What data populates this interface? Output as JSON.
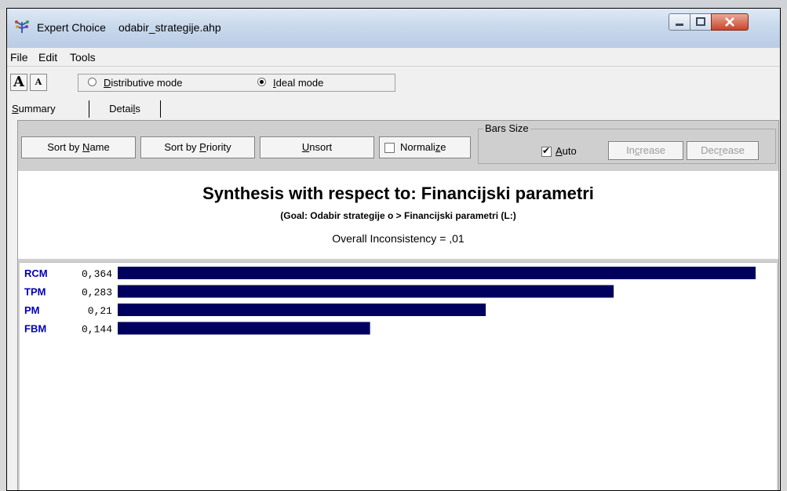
{
  "window": {
    "app_name": "Expert Choice",
    "file_name": "odabir_strategije.ahp"
  },
  "menu": [
    "File",
    "Edit",
    "Tools"
  ],
  "toolbar": {
    "font_up_label": "A",
    "font_down_label": "A",
    "modes": [
      {
        "label_prefix": "",
        "underline": "D",
        "label_rest": "istributive mode",
        "selected": false
      },
      {
        "label_prefix": "",
        "underline": "I",
        "label_rest": "deal mode",
        "selected": true
      }
    ]
  },
  "tabs": [
    {
      "prefix": "",
      "underline": "S",
      "rest": "ummary",
      "active": true
    },
    {
      "prefix": "Detai",
      "underline": "l",
      "rest": "s",
      "active": false
    }
  ],
  "buttons": {
    "sort_name": {
      "prefix": "Sort by ",
      "underline": "N",
      "rest": "ame"
    },
    "sort_priority": {
      "prefix": "Sort by ",
      "underline": "P",
      "rest": "riority"
    },
    "unsort": {
      "prefix": "",
      "underline": "U",
      "rest": "nsort"
    },
    "normalize": {
      "prefix": "Normali",
      "underline": "z",
      "rest": "e",
      "checked": false
    }
  },
  "bars_size": {
    "legend": "Bars Size",
    "auto": {
      "prefix": "",
      "underline": "A",
      "rest": "uto",
      "checked": true
    },
    "increase": {
      "prefix": "In",
      "underline": "c",
      "rest": "rease"
    },
    "decrease": {
      "prefix": "Dec",
      "underline": "r",
      "rest": "ease"
    }
  },
  "synthesis": {
    "title": "Synthesis with respect to: Financijski parametri",
    "goal": "(Goal: Odabir strategije o > Financijski parametri (L:)",
    "inconsistency": "Overall Inconsistency = ,01"
  },
  "colors": {
    "bar": "#00005e",
    "label": "#0000b4"
  },
  "chart_data": {
    "type": "bar",
    "categories": [
      "RCM",
      "TPM",
      "PM",
      "FBM"
    ],
    "value_labels": [
      "0,364",
      "0,283",
      "0,21",
      "0,144"
    ],
    "values": [
      0.364,
      0.283,
      0.21,
      0.144
    ],
    "max_value": 0.364
  }
}
